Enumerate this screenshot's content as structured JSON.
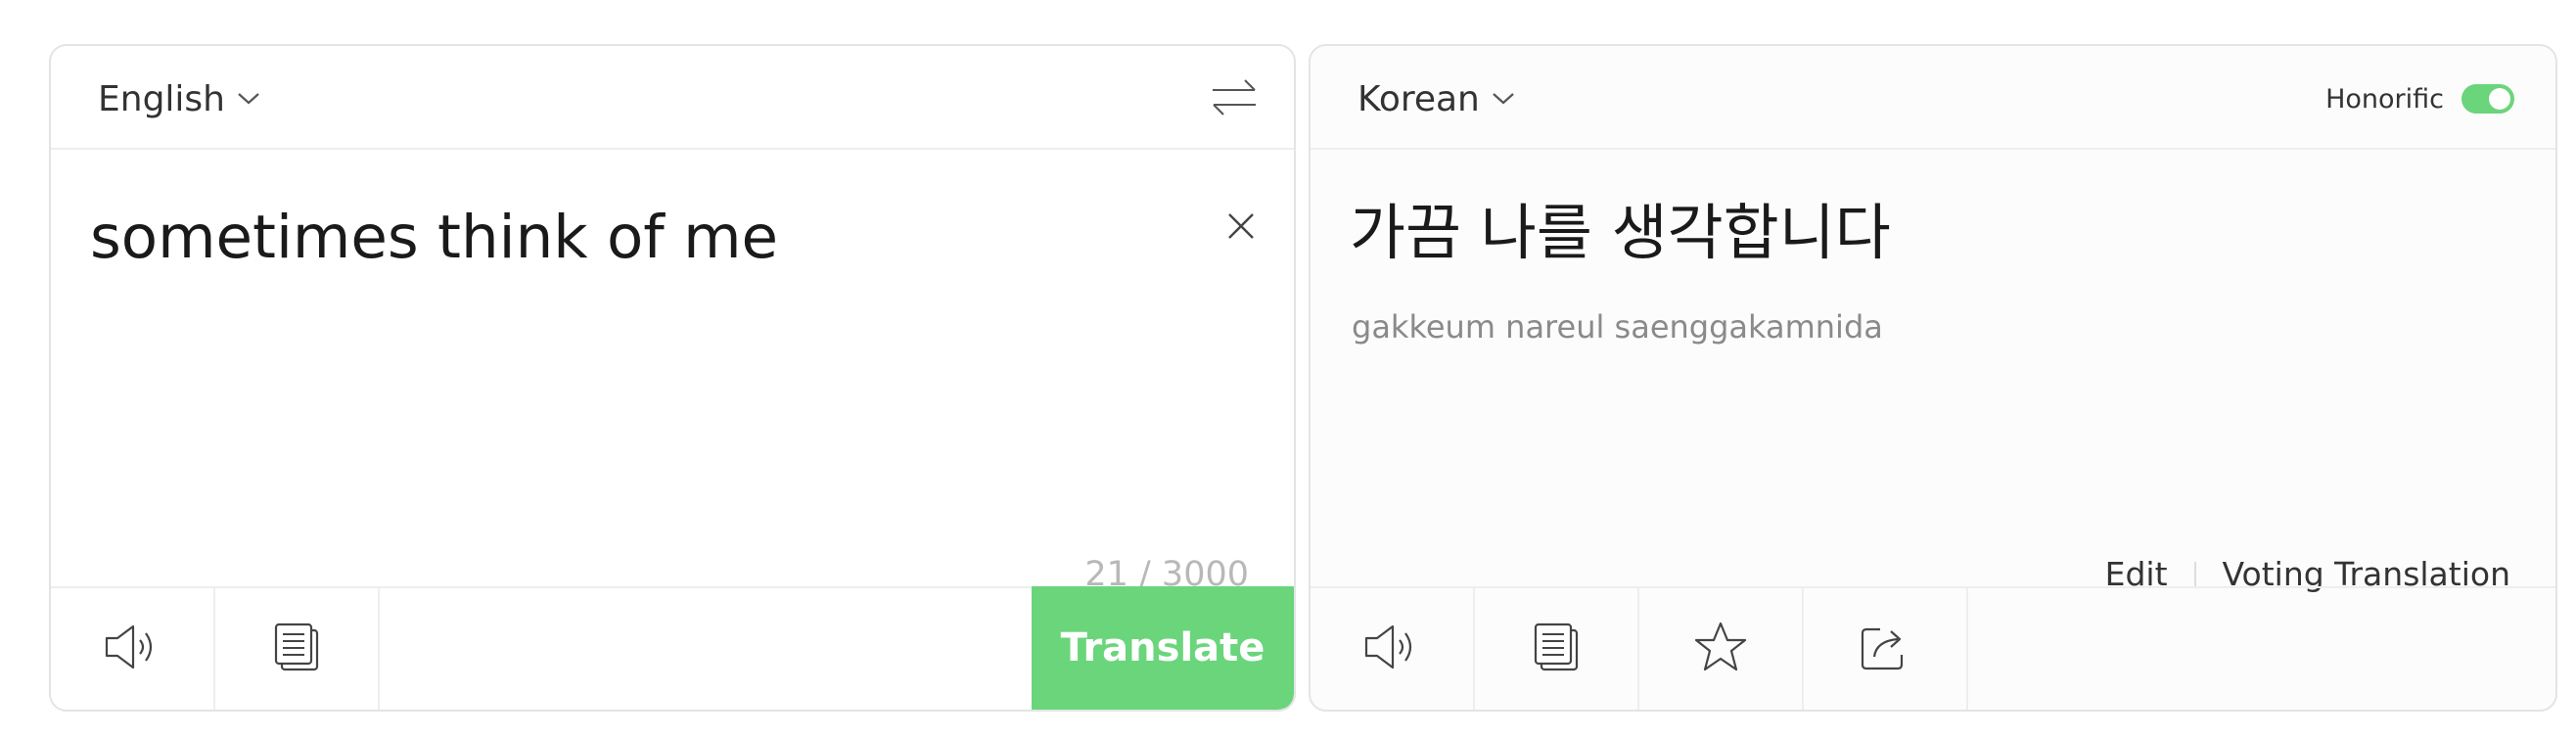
{
  "source": {
    "language": "English",
    "text": "sometimes think of me",
    "counter": "21 / 3000",
    "translate_label": "Translate"
  },
  "target": {
    "language": "Korean",
    "honorific_label": "Honorific",
    "honorific_enabled": true,
    "text": "가끔 나를 생각합니다",
    "romanization": "gakkeum nareul saenggakamnida",
    "edit_label": "Edit",
    "voting_label": "Voting Translation"
  },
  "colors": {
    "accent": "#6ad57b",
    "border": "#e4e4e4",
    "counter": "#b8b8b8",
    "romanization": "#8a8a8a"
  },
  "icons": {
    "source_footer": [
      "speaker-icon",
      "copy-icon"
    ],
    "target_footer": [
      "speaker-icon",
      "copy-icon",
      "star-icon",
      "share-icon"
    ]
  }
}
